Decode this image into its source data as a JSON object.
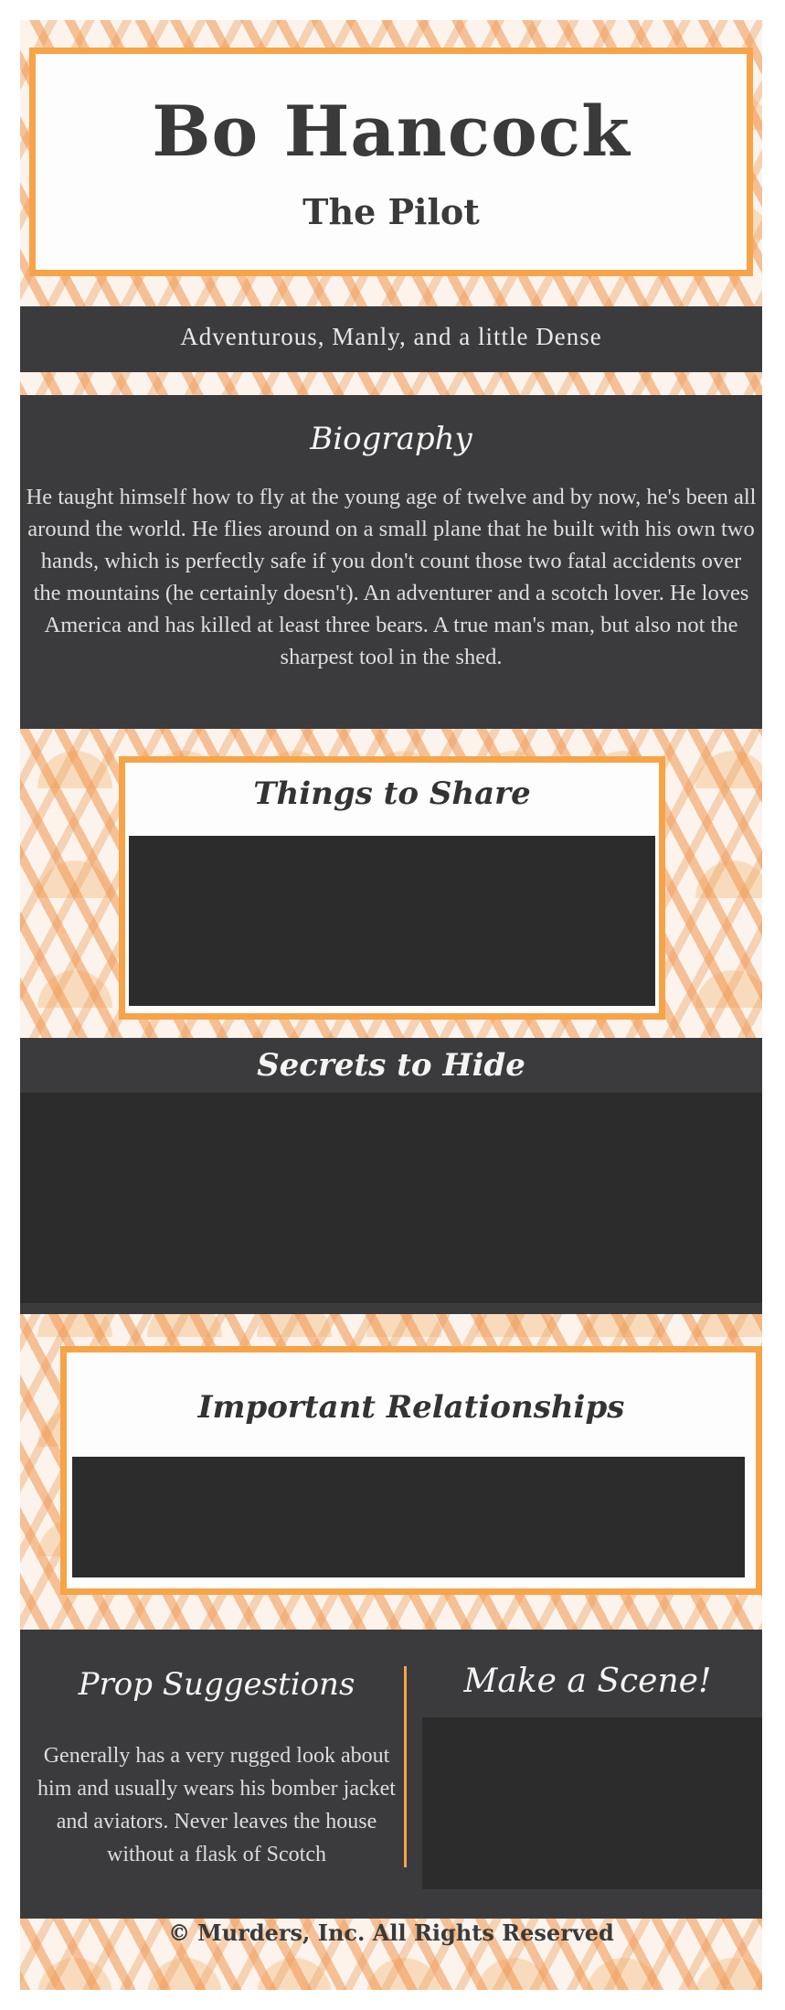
{
  "header": {
    "name": "Bo Hancock",
    "role": "The Pilot"
  },
  "tagline": "Adventurous, Manly, and a little Dense",
  "biography": {
    "heading": "Biography",
    "text": "He taught himself how to fly at the young age of twelve and by now, he's been all around the world. He flies around on a small plane that he built with his own two hands, which is perfectly safe if you don't count those two fatal accidents over the mountains (he certainly doesn't). An adventurer and a scotch lover. He loves America and has killed at least three bears. A true man's man, but also not the sharpest tool in the shed."
  },
  "things_to_share": {
    "heading": "Things to Share"
  },
  "secrets_to_hide": {
    "heading": "Secrets to Hide"
  },
  "relationships": {
    "heading": "Important Relationships"
  },
  "props": {
    "heading": "Prop Suggestions",
    "text": "Generally has a very rugged look about him and usually wears his bomber jacket and aviators.  Never leaves the house without a flask of Scotch"
  },
  "make_a_scene": {
    "heading": "Make a Scene!"
  },
  "footer": {
    "symbol": "©",
    "text": "Murders, Inc. All Rights Reserved"
  },
  "colors": {
    "accent_orange": "#f6a447",
    "band_dark": "#3b3b3d",
    "redaction": "#2c2c2c"
  }
}
